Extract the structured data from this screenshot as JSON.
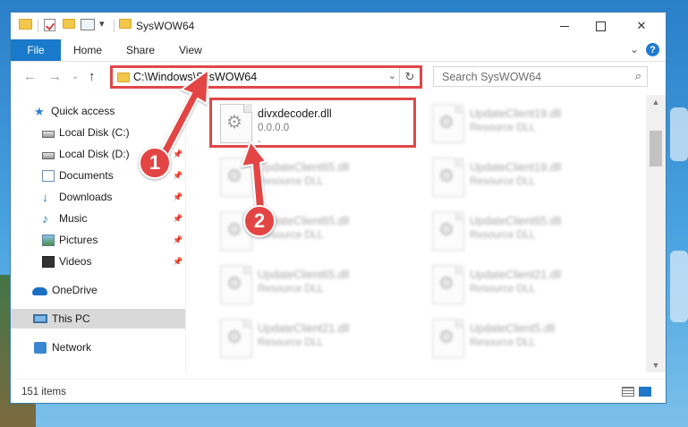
{
  "window": {
    "title": "SysWOW64",
    "controls": {
      "minimize": "",
      "maximize": "",
      "close": "✕"
    }
  },
  "ribbon": {
    "tabs": [
      "File",
      "Home",
      "Share",
      "View"
    ],
    "expand_icon": "⌄",
    "help_icon": "?"
  },
  "navigation": {
    "back": "←",
    "forward": "→",
    "recent": "⌄",
    "up": "↑"
  },
  "address": {
    "path": "C:\\Windows\\SysWOW64",
    "dropdown": "⌄",
    "refresh": "↻"
  },
  "search": {
    "placeholder": "Search SysWOW64",
    "icon": "⌕"
  },
  "sidebar": {
    "items": [
      {
        "label": "Quick access",
        "icon": "star-icon"
      },
      {
        "label": "Local Disk (C:)",
        "icon": "drive-icon"
      },
      {
        "label": "Local Disk (D:)",
        "icon": "drive-icon"
      },
      {
        "label": "Documents",
        "icon": "documents-icon"
      },
      {
        "label": "Downloads",
        "icon": "downloads-icon"
      },
      {
        "label": "Music",
        "icon": "music-icon"
      },
      {
        "label": "Pictures",
        "icon": "pictures-icon"
      },
      {
        "label": "Videos",
        "icon": "videos-icon"
      },
      {
        "label": "OneDrive",
        "icon": "onedrive-icon"
      },
      {
        "label": "This PC",
        "icon": "computer-icon"
      },
      {
        "label": "Network",
        "icon": "network-icon"
      }
    ],
    "pin_glyph": "📌"
  },
  "files": [
    {
      "name": "divxdecoder.dll",
      "sub": "0.0.0.0",
      "sub2": "-"
    },
    {
      "name": "UpdateClient19.dll",
      "sub": "Resource DLL"
    },
    {
      "name": "UpdateClient65.dll",
      "sub": "Resource DLL"
    },
    {
      "name": "UpdateClient19.dll",
      "sub": "Resource DLL"
    },
    {
      "name": "UpdateClient65.dll",
      "sub": "Resource DLL"
    },
    {
      "name": "UpdateClient65.dll",
      "sub": "Resource DLL"
    },
    {
      "name": "UpdateClient65.dll",
      "sub": "Resource DLL"
    },
    {
      "name": "UpdateClient21.dll",
      "sub": "Resource DLL"
    },
    {
      "name": "UpdateClient21.dll",
      "sub": "Resource DLL"
    },
    {
      "name": "UpdateClient5.dll",
      "sub": "Resource DLL"
    }
  ],
  "gear_glyph": "⚙",
  "statusbar": {
    "count": "151 items"
  },
  "scroll": {
    "up": "▲",
    "down": "▼"
  },
  "annotations": {
    "step1": "1",
    "step2": "2",
    "color": "#e34545"
  }
}
